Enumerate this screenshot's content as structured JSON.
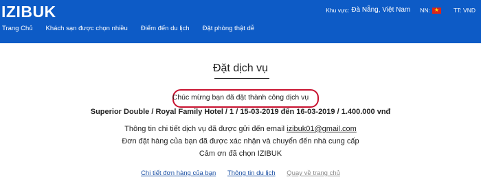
{
  "header": {
    "logo": "IZIBUK",
    "region_label": "Khu vực:",
    "region_value": "Đà Nẵng, Việt Nam",
    "language_label": "NN:",
    "flag_icon": "vietnam-flag-icon",
    "account": "TT: VND"
  },
  "nav": {
    "items": [
      {
        "label": "Trang Chủ"
      },
      {
        "label": "Khách sạn được chọn nhiều"
      },
      {
        "label": "Điểm đến du lịch"
      },
      {
        "label": "Đặt phòng thật dễ"
      }
    ]
  },
  "main": {
    "title": "Đặt dịch vụ",
    "congrats": "Chúc mừng bạn đã đặt thành công dịch vụ",
    "booking_summary": "Superior Double / Royal Family Hotel / 1 / 15-03-2019 đến 16-03-2019 / 1.400.000 vnđ",
    "info_prefix": "Thông tin chi tiết dịch vụ đã được gửi đến email",
    "email": "izibuk01@gmail.com",
    "confirm_line": "Đơn đặt hàng của bạn đã được xác nhận và chuyển đến nhà cung cấp",
    "thanks_line": "Cảm ơn đã chọn IZIBUK"
  },
  "links": {
    "order_details": "Chi tiết đơn hàng của bạn",
    "travel_info": "Thông tin du lịch",
    "back_home": "Quay về trang chủ"
  },
  "colors": {
    "header_bg": "#0d5bc6",
    "highlight_border": "#c8102e",
    "link": "#1a4fa3"
  }
}
